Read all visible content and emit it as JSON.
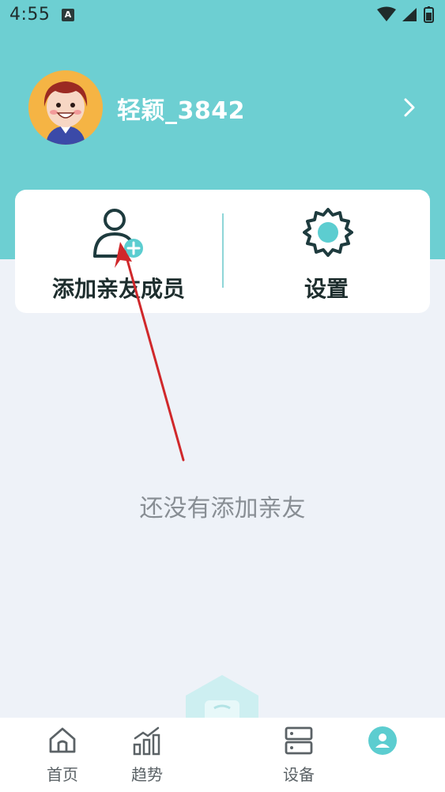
{
  "status_bar": {
    "time": "4:55",
    "badge": "A"
  },
  "profile": {
    "username": "轻颖_3842"
  },
  "card": {
    "add_member_label": "添加亲友成员",
    "settings_label": "设置"
  },
  "empty_state": {
    "text": "还没有添加亲友"
  },
  "tabbar": {
    "home_label": "首页",
    "trend_label": "趋势",
    "device_label": "设备"
  },
  "colors": {
    "header_bg": "#6dcfd2",
    "accent": "#5ccdd0",
    "icon_dark": "#1e3b3e",
    "annotation_arrow": "#d0282b"
  }
}
